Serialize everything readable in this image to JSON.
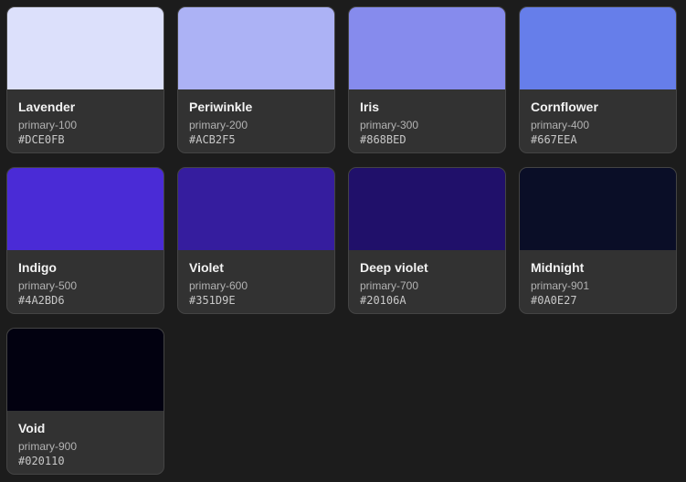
{
  "swatches": [
    {
      "name": "Lavender",
      "token": "primary-100",
      "hex": "#DCE0FB",
      "color": "#DCE0FB"
    },
    {
      "name": "Periwinkle",
      "token": "primary-200",
      "hex": "#ACB2F5",
      "color": "#ACB2F5"
    },
    {
      "name": "Iris",
      "token": "primary-300",
      "hex": "#868BED",
      "color": "#868BED"
    },
    {
      "name": "Cornflower",
      "token": "primary-400",
      "hex": "#667EEA",
      "color": "#667EEA"
    },
    {
      "name": "Indigo",
      "token": "primary-500",
      "hex": "#4A2BD6",
      "color": "#4A2BD6"
    },
    {
      "name": "Violet",
      "token": "primary-600",
      "hex": "#351D9E",
      "color": "#351D9E"
    },
    {
      "name": "Deep violet",
      "token": "primary-700",
      "hex": "#20106A",
      "color": "#20106A"
    },
    {
      "name": "Midnight",
      "token": "primary-901",
      "hex": "#0A0E27",
      "color": "#0A0E27"
    },
    {
      "name": "Void",
      "token": "primary-900",
      "hex": "#020110",
      "color": "#020110"
    }
  ]
}
